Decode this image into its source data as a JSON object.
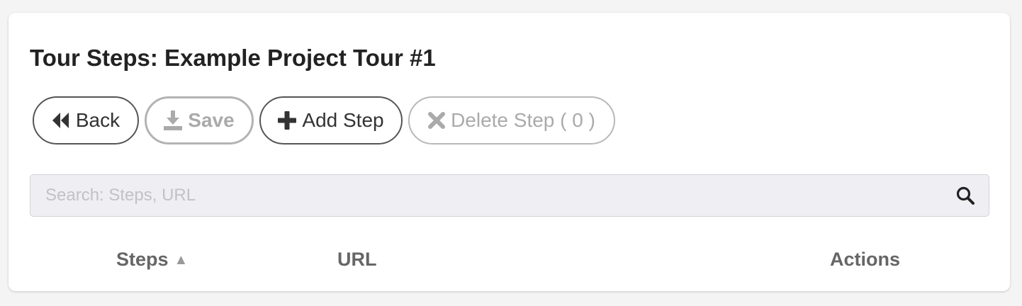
{
  "page": {
    "title": "Tour Steps: Example Project Tour #1"
  },
  "toolbar": {
    "back_label": "Back",
    "back_icon": "backward-icon",
    "save_label": "Save",
    "save_icon": "download-icon",
    "add_label": "Add Step",
    "add_icon": "plus-icon",
    "delete_label": "Delete Step ( 0 )",
    "delete_icon": "x-icon"
  },
  "search": {
    "placeholder": "Search: Steps, URL",
    "value": "",
    "icon": "search-icon"
  },
  "table": {
    "columns": [
      {
        "label": "Steps",
        "sort": "▲"
      },
      {
        "label": "URL"
      },
      {
        "label": "Actions"
      }
    ],
    "rows": []
  },
  "colors": {
    "background": "#f4f4f4",
    "card": "#ffffff",
    "active_border": "#555555",
    "disabled_text": "#aaaaaa",
    "search_background": "#efeff3"
  }
}
